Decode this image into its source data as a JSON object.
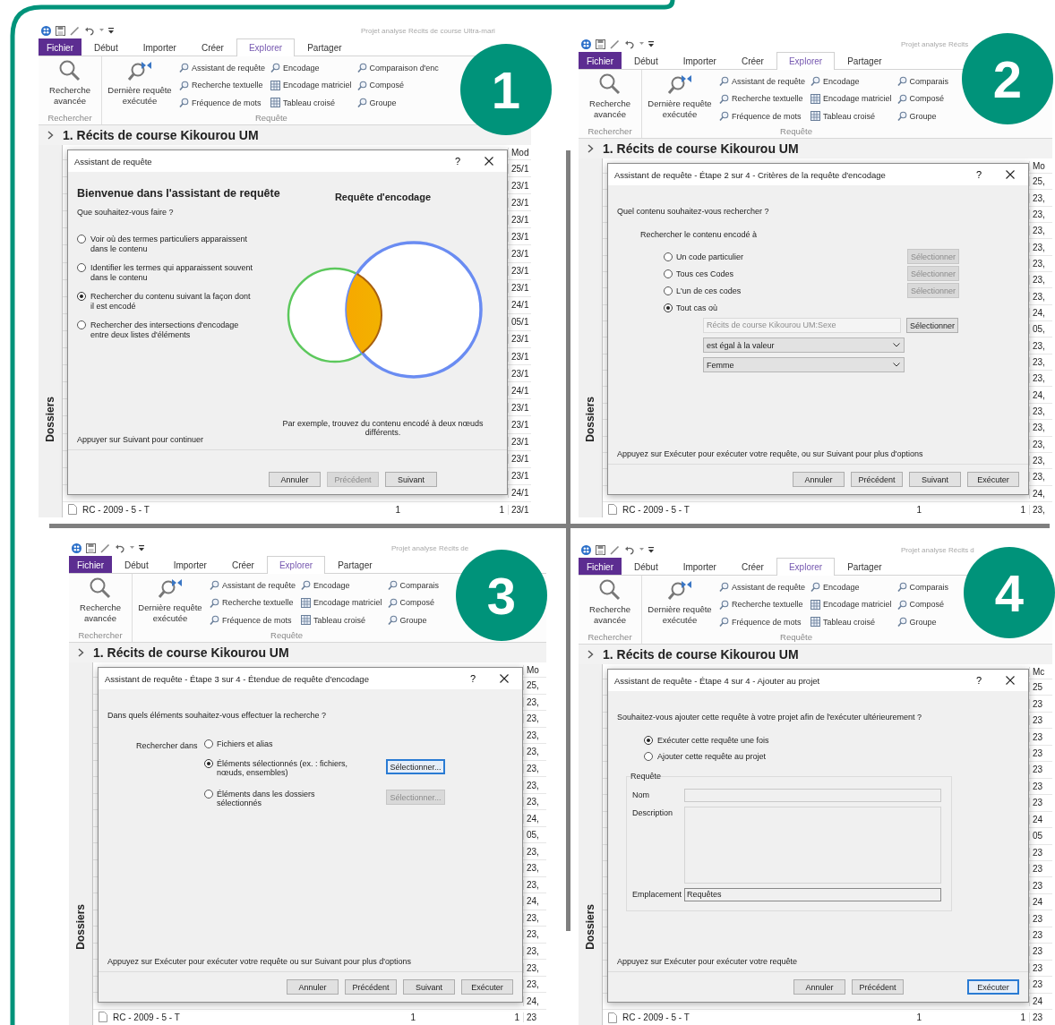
{
  "panels": [
    {
      "step": "1",
      "window_title": "Projet analyse Récits de course Ultra-mari",
      "tabs": [
        {
          "label": "Fichier",
          "kind": "file",
          "selected": false
        },
        {
          "label": "Début",
          "kind": "tab",
          "selected": false
        },
        {
          "label": "Importer",
          "kind": "tab",
          "selected": false
        },
        {
          "label": "Créer",
          "kind": "tab",
          "selected": false
        },
        {
          "label": "Explorer",
          "kind": "tab",
          "selected": true
        },
        {
          "label": "Partager",
          "kind": "tab",
          "selected": false
        }
      ],
      "ribbon": [
        {
          "label": "Rechercher",
          "large": [
            {
              "label": "Recherche avancée"
            }
          ]
        },
        {
          "label": "Requête",
          "large": [
            {
              "label": "Dernière requête exécutée"
            }
          ],
          "small": [
            {
              "label": "Assistant de requête"
            },
            {
              "label": "Recherche textuelle"
            },
            {
              "label": "Fréquence de mots"
            },
            {
              "label": "Encodage"
            },
            {
              "label": "Encodage matriciel"
            },
            {
              "label": "Tableau croisé"
            },
            {
              "label": "Comparaison d'enc"
            },
            {
              "label": "Composé"
            },
            {
              "label": "Groupe"
            }
          ]
        }
      ],
      "project_title": "1. Récits de course Kikourou UM",
      "sidebar_label": "Dossiers",
      "list": {
        "header": "Mod",
        "dates": [
          "25/1",
          "23/1",
          "23/1",
          "23/1",
          "23/1",
          "23/1",
          "23/1",
          "23/1",
          "24/1",
          "05/1",
          "23/1",
          "23/1",
          "23/1",
          "24/1",
          "23/1",
          "23/1",
          "23/1",
          "23/1",
          "23/1",
          "24/1"
        ],
        "last_row": {
          "name": "RC - 2009 - 5 - T",
          "col_2": "1",
          "col_3": "1",
          "date": "23/1"
        }
      },
      "dialog": {
        "kind": "welcome",
        "title": "Assistant de requête",
        "help": "?",
        "heading": "Bienvenue dans l'assistant de requête",
        "question": "Que souhaitez-vous faire ?",
        "options": [
          {
            "label": "Voir où des termes particuliers apparaissent dans le contenu",
            "selected": false
          },
          {
            "label": "Identifier les termes qui apparaissent souvent dans le contenu",
            "selected": false
          },
          {
            "label": "Rechercher du contenu suivant la façon dont il est encodé",
            "selected": true
          },
          {
            "label": "Rechercher des intersections d'encodage entre deux listes d'éléments",
            "selected": false
          }
        ],
        "preview_title": "Requête d'encodage",
        "preview_caption": "Par exemple, trouvez du contenu encodé à deux nœuds différents.",
        "hint": "Appuyer sur Suivant pour continuer",
        "buttons": [
          {
            "label": "Annuler",
            "disabled": false,
            "focused": false
          },
          {
            "label": "Précédent",
            "disabled": true,
            "focused": false
          },
          {
            "label": "Suivant",
            "disabled": false,
            "focused": false
          }
        ]
      }
    },
    {
      "step": "2",
      "window_title": "Projet analyse Récits",
      "tabs": [
        {
          "label": "Fichier",
          "kind": "file",
          "selected": false
        },
        {
          "label": "Début",
          "kind": "tab",
          "selected": false
        },
        {
          "label": "Importer",
          "kind": "tab",
          "selected": false
        },
        {
          "label": "Créer",
          "kind": "tab",
          "selected": false
        },
        {
          "label": "Explorer",
          "kind": "tab",
          "selected": true
        },
        {
          "label": "Partager",
          "kind": "tab",
          "selected": false
        }
      ],
      "ribbon": [
        {
          "label": "Rechercher",
          "large": [
            {
              "label": "Recherche avancée"
            }
          ]
        },
        {
          "label": "Requête",
          "large": [
            {
              "label": "Dernière requête exécutée"
            }
          ],
          "small": [
            {
              "label": "Assistant de requête"
            },
            {
              "label": "Recherche textuelle"
            },
            {
              "label": "Fréquence de mots"
            },
            {
              "label": "Encodage"
            },
            {
              "label": "Encodage matriciel"
            },
            {
              "label": "Tableau croisé"
            },
            {
              "label": "Comparais"
            },
            {
              "label": "Composé"
            },
            {
              "label": "Groupe"
            }
          ]
        }
      ],
      "project_title": "1. Récits de course Kikourou UM",
      "sidebar_label": "Dossiers",
      "list": {
        "header": "Mo",
        "dates": [
          "25,",
          "23,",
          "23,",
          "23,",
          "23,",
          "23,",
          "23,",
          "23,",
          "24,",
          "05,",
          "23,",
          "23,",
          "23,",
          "24,",
          "23,",
          "23,",
          "23,",
          "23,",
          "23,",
          "24,"
        ],
        "last_row": {
          "name": "RC - 2009 - 5 - T",
          "col_2": "1",
          "col_3": "1",
          "date": "23,"
        }
      },
      "dialog": {
        "kind": "criteria",
        "title": "Assistant de requête - Étape 2 sur 4 - Critères de la requête d'encodage",
        "help": "?",
        "question": "Quel contenu souhaitez-vous rechercher ?",
        "sublabel": "Rechercher le contenu encodé à",
        "options": [
          {
            "label": "Un code particulier",
            "selected": false,
            "button": {
              "label": "Sélectionner",
              "disabled": true,
              "focused": false
            }
          },
          {
            "label": "Tous ces Codes",
            "selected": false,
            "button": {
              "label": "Sélectionner",
              "disabled": true,
              "focused": false
            }
          },
          {
            "label": "L'un de ces codes",
            "selected": false,
            "button": {
              "label": "Sélectionner",
              "disabled": true,
              "focused": false
            }
          },
          {
            "label": "Tout cas où",
            "selected": true
          }
        ],
        "criteria": {
          "field": "Récits de course Kikourou UM:Sexe",
          "field_button": {
            "label": "Sélectionner",
            "disabled": false,
            "focused": false
          },
          "operator": "est égal à la valeur",
          "value": "Femme"
        },
        "hint": "Appuyez sur Exécuter pour exécuter votre requête, ou sur Suivant pour plus d'options",
        "buttons": [
          {
            "label": "Annuler",
            "disabled": false,
            "focused": false
          },
          {
            "label": "Précédent",
            "disabled": false,
            "focused": false
          },
          {
            "label": "Suivant",
            "disabled": false,
            "focused": false
          },
          {
            "label": "Exécuter",
            "disabled": false,
            "focused": false
          }
        ]
      }
    },
    {
      "step": "3",
      "window_title": "Projet analyse Récits de",
      "tabs": [
        {
          "label": "Fichier",
          "kind": "file",
          "selected": false
        },
        {
          "label": "Début",
          "kind": "tab",
          "selected": false
        },
        {
          "label": "Importer",
          "kind": "tab",
          "selected": false
        },
        {
          "label": "Créer",
          "kind": "tab",
          "selected": false
        },
        {
          "label": "Explorer",
          "kind": "tab",
          "selected": true
        },
        {
          "label": "Partager",
          "kind": "tab",
          "selected": false
        }
      ],
      "ribbon": [
        {
          "label": "Rechercher",
          "large": [
            {
              "label": "Recherche avancée"
            }
          ]
        },
        {
          "label": "Requête",
          "large": [
            {
              "label": "Dernière requête exécutée"
            }
          ],
          "small": [
            {
              "label": "Assistant de requête"
            },
            {
              "label": "Recherche textuelle"
            },
            {
              "label": "Fréquence de mots"
            },
            {
              "label": "Encodage"
            },
            {
              "label": "Encodage matriciel"
            },
            {
              "label": "Tableau croisé"
            },
            {
              "label": "Comparais"
            },
            {
              "label": "Composé"
            },
            {
              "label": "Groupe"
            }
          ]
        }
      ],
      "project_title": "1. Récits de course Kikourou UM",
      "sidebar_label": "Dossiers",
      "list": {
        "header": "Mo",
        "dates": [
          "25,",
          "23,",
          "23,",
          "23,",
          "23,",
          "23,",
          "23,",
          "23,",
          "24,",
          "05,",
          "23,",
          "23,",
          "23,",
          "24,",
          "23,",
          "23,",
          "23,",
          "23,",
          "23,",
          "24,"
        ],
        "last_row": {
          "name": "RC - 2009 - 5 - T",
          "col_2": "1",
          "col_3": "1",
          "date": "23"
        }
      },
      "dialog": {
        "kind": "scope",
        "title": "Assistant de requête - Étape 3 sur 4 - Étendue de requête d'encodage",
        "help": "?",
        "question": "Dans quels éléments souhaitez-vous effectuer la recherche ?",
        "sublabel": "Rechercher dans",
        "options": [
          {
            "label": "Fichiers et alias",
            "selected": false
          },
          {
            "label": "Éléments sélectionnés (ex. : fichiers, nœuds, ensembles)",
            "selected": true,
            "button": {
              "label": "Sélectionner...",
              "disabled": false,
              "focused": true
            }
          },
          {
            "label": "Éléments dans les dossiers sélectionnés",
            "selected": false,
            "button": {
              "label": "Sélectionner...",
              "disabled": true,
              "focused": false
            }
          }
        ],
        "hint": "Appuyez sur Exécuter pour exécuter votre requête ou sur Suivant pour plus d'options",
        "buttons": [
          {
            "label": "Annuler",
            "disabled": false,
            "focused": false
          },
          {
            "label": "Précédent",
            "disabled": false,
            "focused": false
          },
          {
            "label": "Suivant",
            "disabled": false,
            "focused": false
          },
          {
            "label": "Exécuter",
            "disabled": false,
            "focused": false
          }
        ]
      }
    },
    {
      "step": "4",
      "window_title": "Projet analyse Récits d",
      "tabs": [
        {
          "label": "Fichier",
          "kind": "file",
          "selected": false
        },
        {
          "label": "Début",
          "kind": "tab",
          "selected": false
        },
        {
          "label": "Importer",
          "kind": "tab",
          "selected": false
        },
        {
          "label": "Créer",
          "kind": "tab",
          "selected": false
        },
        {
          "label": "Explorer",
          "kind": "tab",
          "selected": true
        },
        {
          "label": "Partager",
          "kind": "tab",
          "selected": false
        }
      ],
      "ribbon": [
        {
          "label": "Rechercher",
          "large": [
            {
              "label": "Recherche avancée"
            }
          ]
        },
        {
          "label": "Requête",
          "large": [
            {
              "label": "Dernière requête exécutée"
            }
          ],
          "small": [
            {
              "label": "Assistant de requête"
            },
            {
              "label": "Recherche textuelle"
            },
            {
              "label": "Fréquence de mots"
            },
            {
              "label": "Encodage"
            },
            {
              "label": "Encodage matriciel"
            },
            {
              "label": "Tableau croisé"
            },
            {
              "label": "Comparais"
            },
            {
              "label": "Composé"
            },
            {
              "label": "Groupe"
            }
          ]
        }
      ],
      "project_title": "1. Récits de course Kikourou UM",
      "sidebar_label": "Dossiers",
      "list": {
        "header": "Mc",
        "dates": [
          "25",
          "23",
          "23",
          "23",
          "23",
          "23",
          "23",
          "23",
          "24",
          "05",
          "23",
          "23",
          "23",
          "24",
          "23",
          "23",
          "23",
          "23",
          "23",
          "24"
        ],
        "last_row": {
          "name": "RC - 2009 - 5 - T",
          "col_2": "1",
          "col_3": "1",
          "date": "23"
        }
      },
      "dialog": {
        "kind": "save",
        "title": "Assistant de requête - Étape 4 sur 4 - Ajouter au projet",
        "help": "?",
        "question": "Souhaitez-vous ajouter cette requête à votre projet afin de l'exécuter ultérieurement ?",
        "options": [
          {
            "label": "Exécuter cette requête une fois",
            "selected": true
          },
          {
            "label": "Ajouter cette requête au projet",
            "selected": false
          }
        ],
        "group": {
          "label": "Requête",
          "fields": [
            {
              "label": "Nom",
              "kind": "line"
            },
            {
              "label": "Description",
              "kind": "area"
            },
            {
              "label": "Emplacement",
              "kind": "line",
              "value": "Requêtes"
            }
          ]
        },
        "hint": "Appuyez sur Exécuter pour exécuter votre requête",
        "buttons": [
          {
            "label": "Annuler",
            "disabled": false,
            "focused": false
          },
          {
            "label": "Précédent",
            "disabled": false,
            "focused": false
          },
          {
            "label": "Exécuter",
            "disabled": false,
            "focused": true
          }
        ]
      }
    }
  ]
}
